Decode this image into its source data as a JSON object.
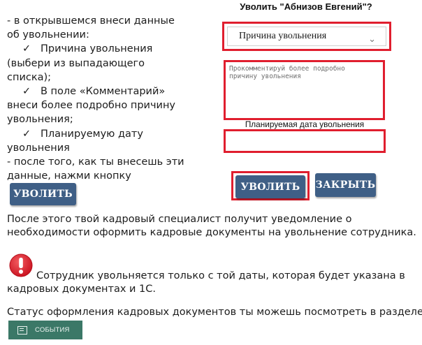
{
  "instructions": {
    "lines": [
      "- в открывшемся внеси данные",
      "об увольнении:",
      "Причина увольнения",
      "(выбери из выпадающего",
      "списка);",
      "В поле «Комментарий»",
      "внеси более подробно причину",
      "увольнения;",
      "Планируемую дату",
      "увольнения",
      "- после того, как ты внесешь эти",
      "данные, нажми кнопку"
    ],
    "check_mark": "✓",
    "inline_button_label": "УВОЛИТЬ"
  },
  "dialog": {
    "title": "Уволить \"Абнизов Евгений\"?",
    "reason_select": {
      "value": "Причина увольнения"
    },
    "comment": {
      "placeholder": "Прокомментируй более подробно\nпричину увольнения"
    },
    "date_label": "Планируемая дата увольнения",
    "date_value": "",
    "dismiss_button": "УВОЛИТЬ",
    "close_button": "ЗАКРЫТЬ"
  },
  "paragraph1": [
    "После этого твой кадровый специалист получит уведомление о",
    "необходимости оформить кадровые документы на увольнение сотрудника."
  ],
  "warning": {
    "icon": "exclamation-icon",
    "line1": "Сотрудник увольняется только с той даты, которая будет указана в",
    "line2": "кадровых документах и 1С."
  },
  "status_line": "Статус оформления кадровых документов ты можешь посмотреть в разделе",
  "events_button": {
    "label": "СОБЫТИЯ",
    "icon": "events-icon"
  },
  "colors": {
    "button_blue": "#3f5f86",
    "highlight_red": "#e01e2e",
    "events_green": "#3b7867",
    "warning_red": "#d7192a"
  }
}
